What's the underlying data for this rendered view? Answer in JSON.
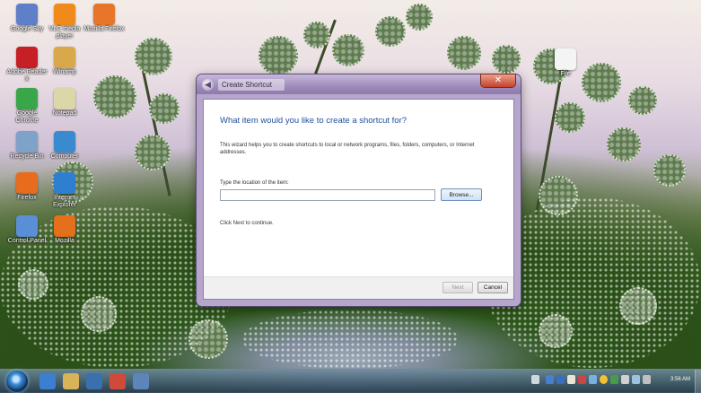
{
  "desktop": {
    "icons": [
      {
        "label": "Google Sky",
        "color": "#5f7fc8"
      },
      {
        "label": "VLC media player",
        "color": "#f08a1a"
      },
      {
        "label": "Mozilla Firefox",
        "color": "#e7762b"
      },
      {
        "label": "Adobe Reader X",
        "color": "#c71f26"
      },
      {
        "label": "Winamp",
        "color": "#d9a84a"
      },
      {
        "label": "Google Chrome",
        "color": "#3aa64a"
      },
      {
        "label": "Notepad",
        "color": "#dcd7a8"
      },
      {
        "label": "Recycle Bin",
        "color": "#7fa2c8"
      },
      {
        "label": "Computer",
        "color": "#3a8ad0"
      },
      {
        "label": "Firefox",
        "color": "#e96b1e"
      },
      {
        "label": "Internet Explorer",
        "color": "#2f7fd0"
      },
      {
        "label": "Control Panel",
        "color": "#5a8fd8"
      },
      {
        "label": "Mozilla",
        "color": "#e46f1d"
      },
      {
        "label": "File",
        "color": "#f4f4f4"
      }
    ]
  },
  "dialog": {
    "title": "Create Shortcut",
    "close_glyph": "✕",
    "back_glyph": "◀",
    "heading": "What item would you like to create a shortcut for?",
    "description": "This wizard helps you to create shortcuts to local or network programs, files, folders, computers, or Internet addresses.",
    "location_label": "Type the location of the item:",
    "location_value": "",
    "browse_label": "Browse...",
    "hint": "Click Next to continue.",
    "next_label": "Next",
    "cancel_label": "Cancel"
  },
  "taskbar": {
    "clock": "3:56 AM",
    "pinned": [
      {
        "name": "internet-explorer",
        "color": "#3a7fd0"
      },
      {
        "name": "explorer",
        "color": "#d9b35a"
      },
      {
        "name": "media-player",
        "color": "#3a6fb0"
      },
      {
        "name": "chrome",
        "color": "#d04a3a"
      },
      {
        "name": "window",
        "color": "#5d86b8"
      }
    ]
  }
}
